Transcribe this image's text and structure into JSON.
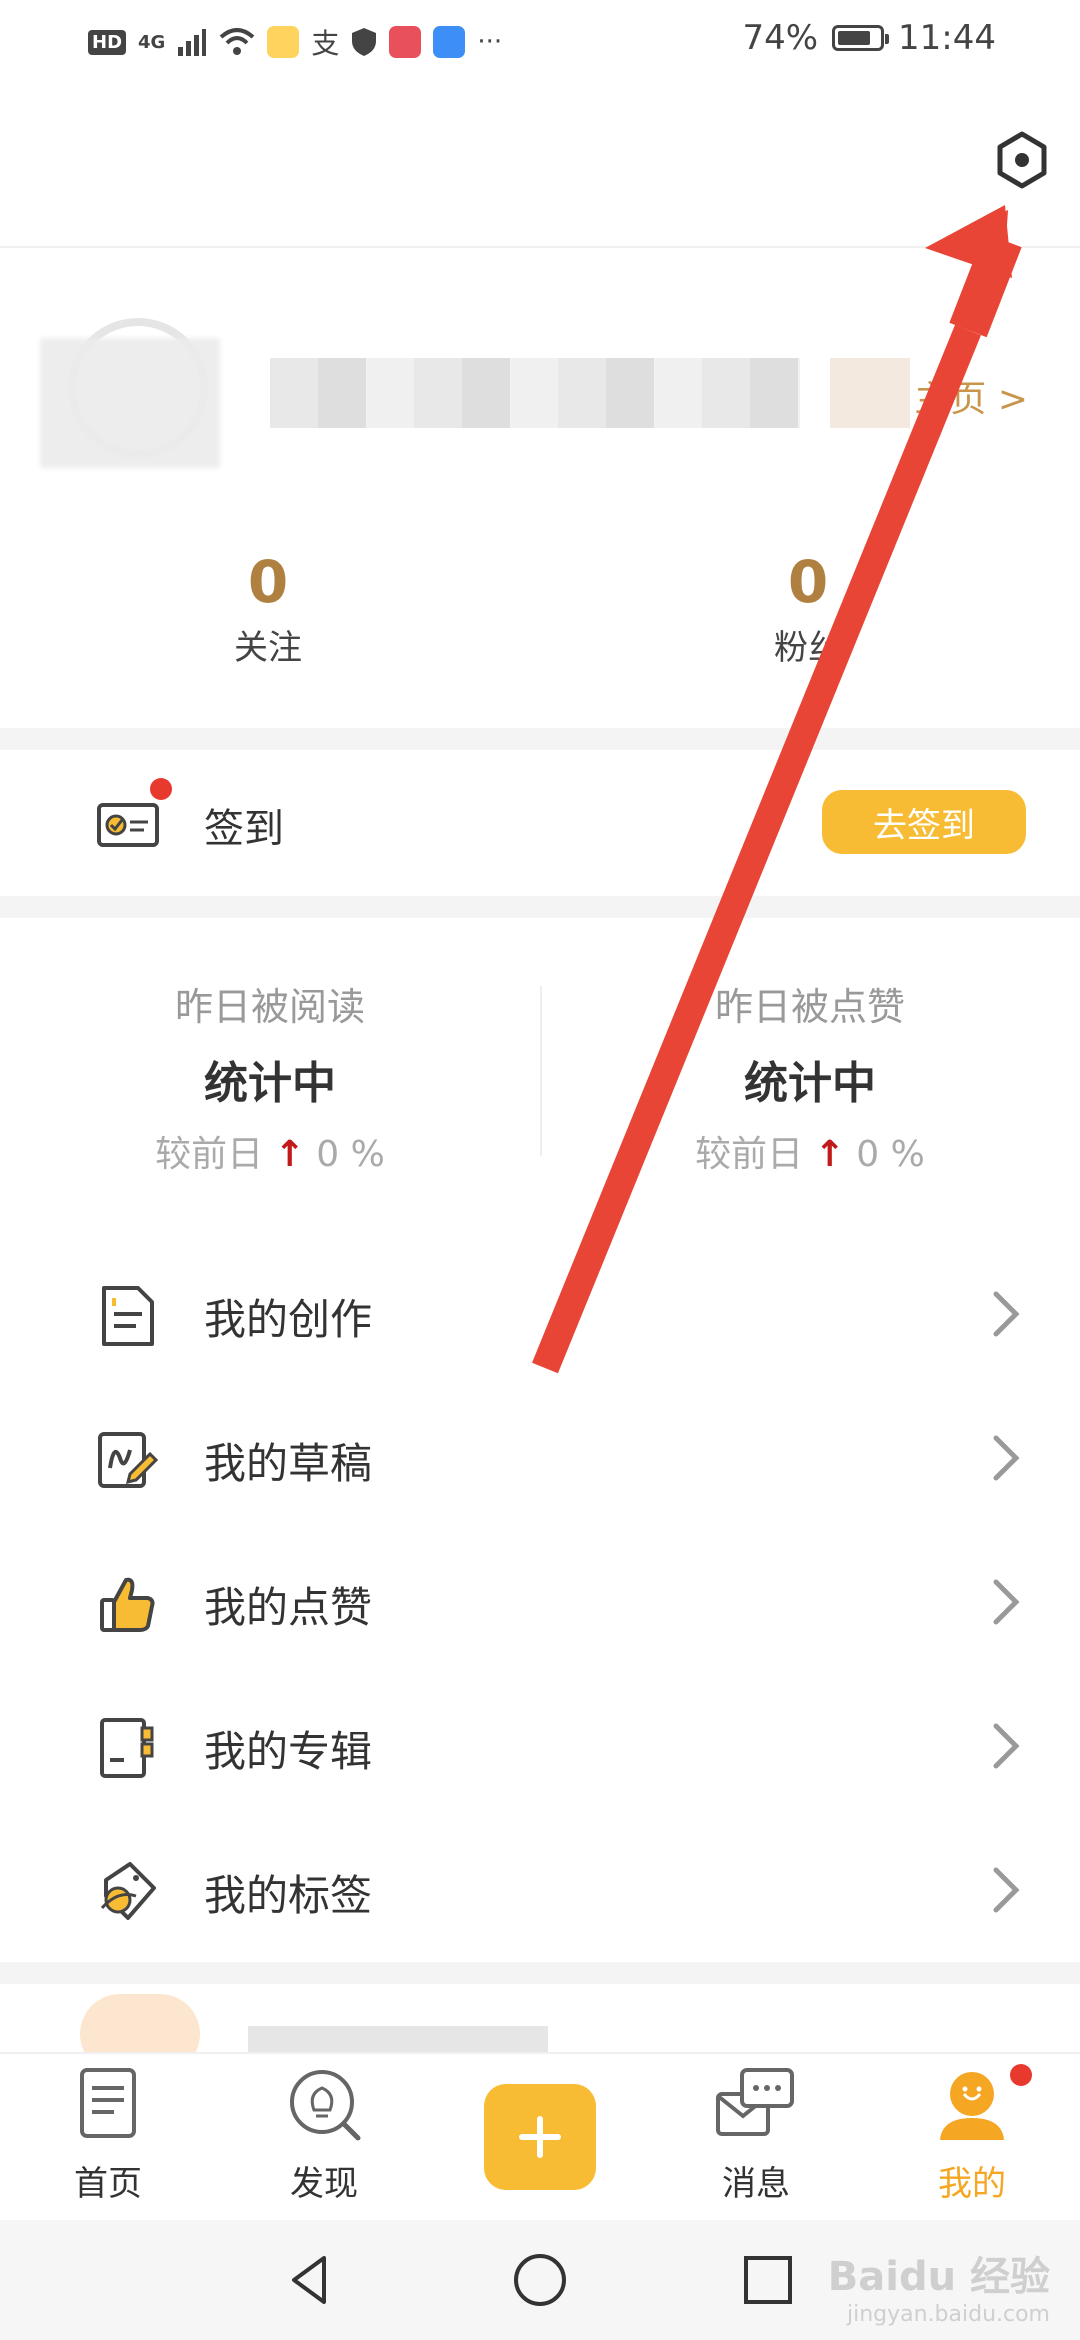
{
  "status_bar": {
    "hd": "HD",
    "network": "4G",
    "battery": "74%",
    "time": "11:44",
    "more": "···",
    "battery_level": 0.74
  },
  "header": {
    "settings_icon": "settings-hexagon-icon"
  },
  "profile": {
    "homepage_link": "主页 >",
    "following_count": "0",
    "following_label": "关注",
    "fans_count": "0",
    "fans_label": "粉丝"
  },
  "checkin": {
    "label": "签到",
    "button": "去签到"
  },
  "stats": {
    "left_title": "昨日被阅读",
    "left_value": "统计中",
    "left_compare_prefix": "较前日",
    "left_compare_value": "0 %",
    "right_title": "昨日被点赞",
    "right_value": "统计中",
    "right_compare_prefix": "较前日",
    "right_compare_value": "0 %"
  },
  "menu": {
    "items": [
      {
        "label": "我的创作",
        "icon": "document-icon"
      },
      {
        "label": "我的草稿",
        "icon": "draft-pencil-icon"
      },
      {
        "label": "我的点赞",
        "icon": "thumbs-up-icon"
      },
      {
        "label": "我的专辑",
        "icon": "album-icon"
      },
      {
        "label": "我的标签",
        "icon": "tag-icon"
      }
    ]
  },
  "tabbar": {
    "items": [
      {
        "label": "首页",
        "icon": "home-doc-icon"
      },
      {
        "label": "发现",
        "icon": "discover-bulb-icon"
      },
      {
        "label": "",
        "icon": "plus-icon"
      },
      {
        "label": "消息",
        "icon": "message-icon"
      },
      {
        "label": "我的",
        "icon": "profile-icon"
      }
    ],
    "active_color": "#f5a623"
  },
  "watermark": {
    "text": "Baidu 经验",
    "sub": "jingyan.baidu.com"
  },
  "colors": {
    "accent": "#f8bc34",
    "gold_text": "#b08040",
    "badge_red": "#e8392f",
    "arrow_red": "#e84537"
  }
}
